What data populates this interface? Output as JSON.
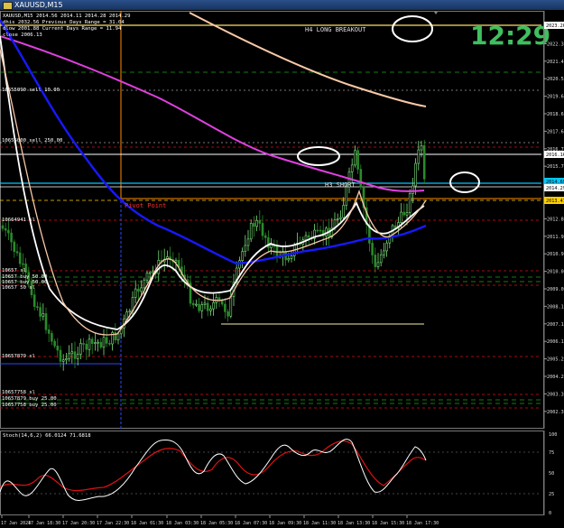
{
  "window": {
    "title": "XAUUSD,M15"
  },
  "info_lines": [
    "XAUUSD,M15  2014.56 2014.11 2014.28 2014.29",
    "dhis 2032.56   Previous Days Range = 31.04",
    "dlow 2001.88   Current Days Range = 11.94",
    "close 2006.13"
  ],
  "clock": {
    "text": "12:29",
    "color": "#3fbf5f"
  },
  "labels": {
    "h4_long_breakout": "H4 LONG BREAKOUT",
    "h3_short": "H3 SHORT",
    "pivot_point": "Pivot Point"
  },
  "order_labels": [
    "10655090 sell 10.00",
    "10655000 sell 250.00",
    "10664941 sl",
    "10657 sl",
    "10657 buy 50.00",
    "10657 buy 50.00",
    "10657 50 sl",
    "10657879 sl",
    "10657758 sl",
    "10657879 buy 25.00",
    "10657758 buy 25.00"
  ],
  "price_axis": [
    "2023.36",
    "2022.35",
    "2021.40",
    "2020.55",
    "2019.60",
    "2018.60",
    "2017.65",
    "2016.70",
    "2015.75",
    "2014.75",
    "2013.80",
    "2012.85",
    "2011.90",
    "2010.95",
    "2010.00",
    "2009.05",
    "2008.10",
    "2007.10",
    "2006.15",
    "2005.20",
    "2004.25",
    "2003.30",
    "2002.35"
  ],
  "price_tags": [
    {
      "text": "2023.26",
      "color": "#ffffff"
    },
    {
      "text": "2016.16",
      "color": "#ffffff"
    },
    {
      "text": "2014.69",
      "color": "#00c8ff"
    },
    {
      "text": "2014.29",
      "color": "#ffffff"
    },
    {
      "text": "2013.47",
      "color": "#ffd000"
    }
  ],
  "stoch": {
    "label": "Stoch(14,6,2) 66.0124 71.6818",
    "axis": [
      "100",
      "75",
      "50",
      "25",
      "0"
    ]
  },
  "time_axis": [
    "17 Jan 2024",
    "17 Jan 18:30",
    "17 Jan 20:30",
    "17 Jan 22:30",
    "18 Jan 01:30",
    "18 Jan 03:30",
    "18 Jan 05:30",
    "18 Jan 07:30",
    "18 Jan 09:30",
    "18 Jan 11:30",
    "18 Jan 13:30",
    "18 Jan 15:30",
    "18 Jan 17:30"
  ],
  "colors": {
    "bull": "#7ee07e",
    "bear": "#2a8a2a",
    "ma_blue": "#1818ff",
    "ma_magenta": "#e040e0",
    "ma_white": "#ffffff",
    "ma_peach": "#f8c8a8",
    "pivot": "#ff8c00",
    "stoch_main": "#ffffff",
    "stoch_signal": "#dd1111"
  }
}
